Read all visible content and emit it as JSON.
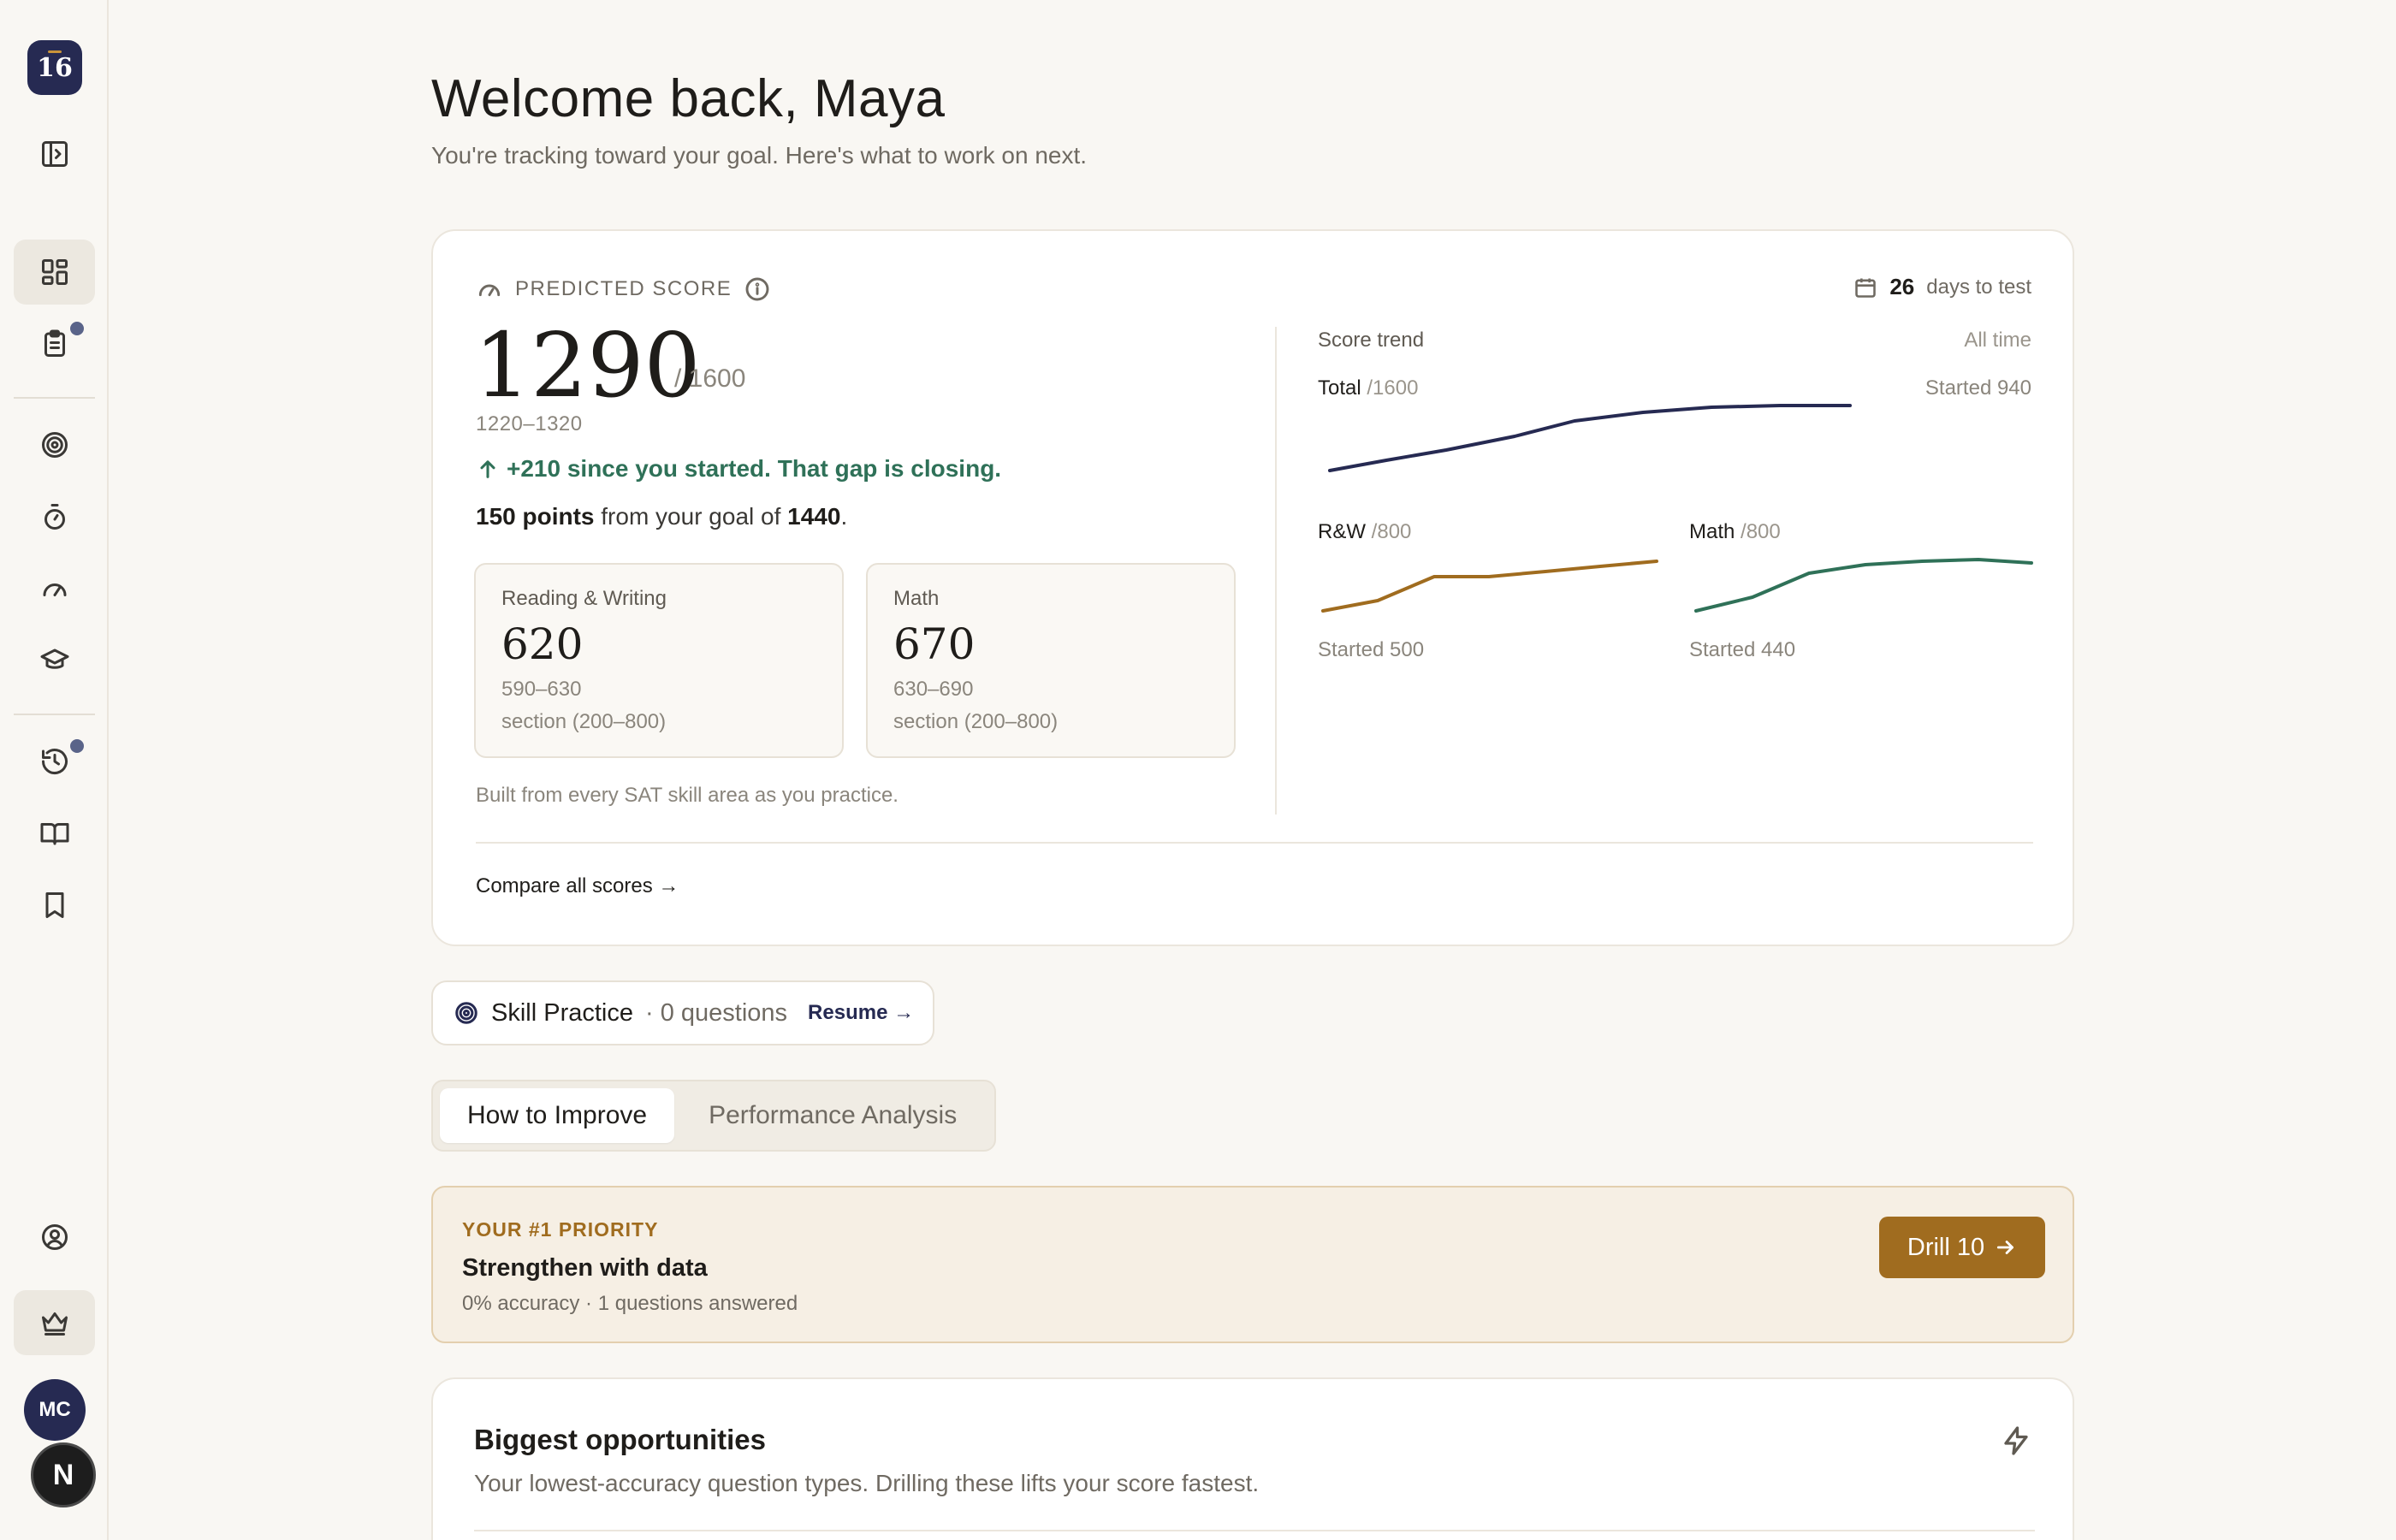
{
  "sidebar": {
    "logo_text": "16",
    "avatar_initials": "MC",
    "badge_letter": "N"
  },
  "header": {
    "title": "Welcome back, Maya",
    "subtitle": "You're tracking toward your goal. Here's what to work on next."
  },
  "predicted": {
    "label": "PREDICTED SCORE",
    "days_number": "26",
    "days_label": "days to test",
    "score": "1290",
    "max": "/ 1600",
    "range": "1220–1320",
    "gain": "+210 since you started. That gap is closing.",
    "goal_points": "150 points",
    "goal_mid": "from your goal of",
    "goal_value": "1440",
    "goal_end": ".",
    "rw": {
      "label": "Reading & Writing",
      "value": "620",
      "range": "590–630",
      "section": "section (200–800)"
    },
    "math": {
      "label": "Math",
      "value": "670",
      "range": "630–690",
      "section": "section (200–800)"
    },
    "built_note": "Built from every SAT skill area as you practice.",
    "compare_link": "Compare all scores →"
  },
  "trend": {
    "title": "Score trend",
    "period": "All time",
    "total_label": "Total",
    "total_max": "/1600",
    "total_started": "Started 940",
    "rw_label": "R&W",
    "rw_max": "/800",
    "rw_started": "Started 500",
    "math_label": "Math",
    "math_max": "/800",
    "math_started": "Started 440",
    "colors": {
      "total": "#262a52",
      "rw": "#a06c1f",
      "math": "#2f7158"
    }
  },
  "skill_practice": {
    "title": "Skill Practice",
    "count": "· 0 questions",
    "resume": "Resume"
  },
  "tabs": [
    {
      "label": "How to Improve",
      "active": true
    },
    {
      "label": "Performance Analysis",
      "active": false
    }
  ],
  "priority": {
    "kicker": "YOUR #1 PRIORITY",
    "title": "Strengthen with data",
    "meta": "0% accuracy · 1 questions answered",
    "button": "Drill 10"
  },
  "opportunities": {
    "title": "Biggest opportunities",
    "description": "Your lowest-accuracy question types. Drilling these lifts your score fastest."
  }
}
